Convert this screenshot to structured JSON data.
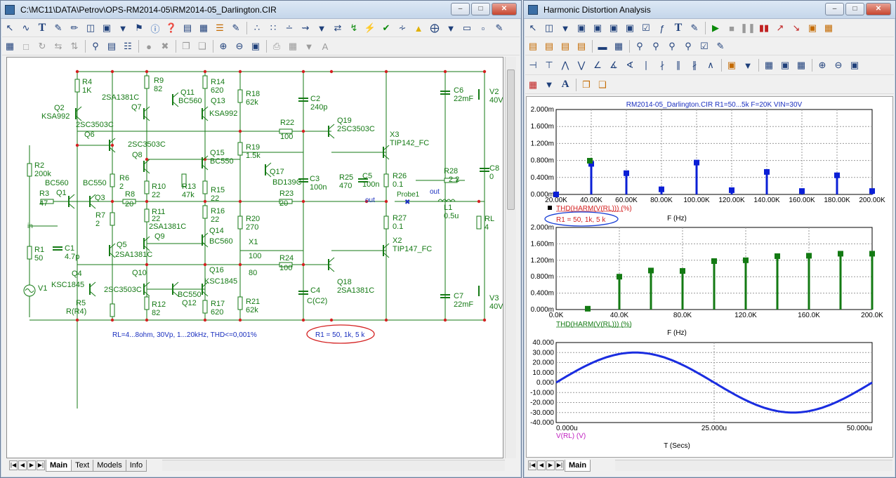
{
  "left_window": {
    "title": "C:\\MC11\\DATA\\Petrov\\OPS-RM2014-05\\RM2014-05_Darlington.CIR",
    "tabs": [
      "Main",
      "Text",
      "Models",
      "Info"
    ],
    "components": [
      {
        "ref": "R4",
        "val": "1K"
      },
      {
        "ref": "Q2",
        "val": "KSA992"
      },
      {
        "ref": "Q6",
        "val": "2SC3503C"
      },
      {
        "ref": "R9",
        "val": "82"
      },
      {
        "ref": "Q7",
        "val": "2SA1381C"
      },
      {
        "ref": "Q11",
        "val": "BC560"
      },
      {
        "ref": "R14",
        "val": "620"
      },
      {
        "ref": "Q13",
        "val": "KSA992"
      },
      {
        "ref": "R18",
        "val": "62k"
      },
      {
        "ref": "C2",
        "val": "240p"
      },
      {
        "ref": "R22",
        "val": "100"
      },
      {
        "ref": "Q19",
        "val": "2SC3503C"
      },
      {
        "ref": "X3",
        "val": "TIP142_FC"
      },
      {
        "ref": "C6",
        "val": "22mF"
      },
      {
        "ref": "V2",
        "val": "40V"
      },
      {
        "ref": "R2",
        "val": "200k"
      },
      {
        "ref": "Q8",
        "val": "2SC3503C"
      },
      {
        "ref": "Q15",
        "val": "BC550"
      },
      {
        "ref": "R19",
        "val": "1.5k"
      },
      {
        "ref": "Q17",
        "val": "BD139C"
      },
      {
        "ref": "C3",
        "val": "100n"
      },
      {
        "ref": "R25",
        "val": "470"
      },
      {
        "ref": "C5",
        "val": "100n"
      },
      {
        "ref": "R26",
        "val": "0.1"
      },
      {
        "ref": "R28",
        "val": "2.2"
      },
      {
        "ref": "C8",
        "val": "0"
      },
      {
        "ref": "Q1",
        "val": "BC560"
      },
      {
        "ref": "Q3",
        "val": "BC550"
      },
      {
        "ref": "R3",
        "val": "47"
      },
      {
        "ref": "R6",
        "val": "2"
      },
      {
        "ref": "R8",
        "val": "20"
      },
      {
        "ref": "R10",
        "val": "22"
      },
      {
        "ref": "R13",
        "val": "47k"
      },
      {
        "ref": "R15",
        "val": "22"
      },
      {
        "ref": "R23",
        "val": "20"
      },
      {
        "ref": "L1",
        "val": "0.5u"
      },
      {
        "ref": "RL",
        "val": "4"
      },
      {
        "ref": "R7",
        "val": "2"
      },
      {
        "ref": "C1",
        "val": "4.7p"
      },
      {
        "ref": "R11",
        "val": "22"
      },
      {
        "ref": "Q9",
        "val": "2SA1381C"
      },
      {
        "ref": "R16",
        "val": "22"
      },
      {
        "ref": "Q14",
        "val": "BC560"
      },
      {
        "ref": "R20",
        "val": "270"
      },
      {
        "ref": "X1",
        "val": "100"
      },
      {
        "ref": "R27",
        "val": "0.1"
      },
      {
        "ref": "X2",
        "val": "TIP147_FC"
      },
      {
        "ref": "R1",
        "val": "50"
      },
      {
        "ref": "Q5",
        "val": "2SA1381C"
      },
      {
        "ref": "Q4",
        "val": "KSC1845"
      },
      {
        "ref": "Q10",
        "val": "2SC3503C"
      },
      {
        "ref": "Q16",
        "val": "KSC1845"
      },
      {
        "ref": "R24",
        "val": "100"
      },
      {
        "ref": "Q18",
        "val": "2SA1381C"
      },
      {
        "ref": "V1",
        "val": ""
      },
      {
        "ref": "R5",
        "val": "R(R4)"
      },
      {
        "ref": "R12",
        "val": "82"
      },
      {
        "ref": "Q12",
        "val": "BC550"
      },
      {
        "ref": "R17",
        "val": "620"
      },
      {
        "ref": "R21",
        "val": "62k"
      },
      {
        "ref": "C4",
        "val": "C(C2)"
      },
      {
        "ref": "C7",
        "val": "22mF"
      },
      {
        "ref": "V3",
        "val": "40V"
      }
    ],
    "node_labels": {
      "in": "in",
      "out": "out",
      "out2": "out",
      "probe": "Probe1",
      "x1_extra": "80"
    },
    "spec_note": "RL=4...8ohm, 30Vp, 1...20kHz, THD<=0,001%",
    "param_note": "R1 = 50, 1k, 5 k"
  },
  "right_window": {
    "title": "Harmonic Distortion Analysis",
    "tabs": [
      "Main"
    ],
    "plot_title": "RM2014-05_Darlington.CIR R1=50...5k F=20K VIN=30V",
    "legend_box": "R1 = 50, 1k, 5 k"
  },
  "chart_data": [
    {
      "type": "bar",
      "title": "RM2014-05_Darlington.CIR R1=50...5k F=20K VIN=30V",
      "ylabel": "THD(HARM(V(RL))) (%)",
      "xlabel": "F (Hz)",
      "x_ticks": [
        "20.00K",
        "40.00K",
        "60.00K",
        "80.00K",
        "100.00K",
        "120.00K",
        "140.00K",
        "160.00K",
        "180.00K",
        "200.00K"
      ],
      "y_ticks": [
        "0.000m",
        "0.400m",
        "0.800m",
        "1.200m",
        "1.600m",
        "2.000m"
      ],
      "ylim": [
        0,
        2.0
      ],
      "color": "#0a1fd6",
      "x": [
        20,
        40,
        60,
        80,
        100,
        120,
        140,
        160,
        180,
        200
      ],
      "values": [
        0.0,
        0.72,
        0.5,
        0.12,
        0.75,
        0.1,
        0.53,
        0.08,
        0.45,
        0.08
      ]
    },
    {
      "type": "bar",
      "ylabel": "THD(HARM(V(RL))) (%)",
      "xlabel": "F (Hz)",
      "x_ticks": [
        "0.0K",
        "40.0K",
        "80.0K",
        "120.0K",
        "160.0K",
        "200.0K"
      ],
      "y_ticks": [
        "0.000m",
        "0.400m",
        "0.800m",
        "1.200m",
        "1.600m",
        "2.000m"
      ],
      "ylim": [
        0,
        2.0
      ],
      "color": "#137a13",
      "x": [
        20,
        40,
        60,
        80,
        100,
        120,
        140,
        160,
        180,
        200
      ],
      "values": [
        0.02,
        0.8,
        0.95,
        0.94,
        1.18,
        1.2,
        1.3,
        1.31,
        1.36,
        1.36
      ]
    },
    {
      "type": "line",
      "ylabel": "V(RL) (V)",
      "xlabel": "T (Secs)",
      "x_ticks": [
        "0.000u",
        "25.000u",
        "50.000u"
      ],
      "y_ticks": [
        "40.000",
        "30.000",
        "20.000",
        "10.000",
        "0.000",
        "-10.000",
        "-20.000",
        "-30.000",
        "-40.000"
      ],
      "ylim": [
        -40,
        40
      ],
      "xlim": [
        0,
        50
      ],
      "amplitude": 30,
      "frequency_khz": 20,
      "color": "#1a2de0"
    }
  ]
}
